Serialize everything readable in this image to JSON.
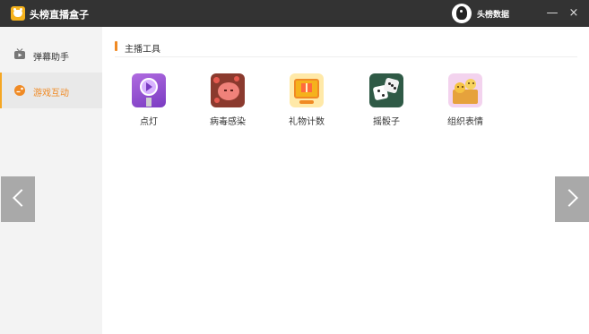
{
  "app": {
    "title": "头榜直播盒子",
    "logo_icon": "bear-face-icon"
  },
  "user": {
    "name": "头榜数据",
    "avatar_icon": "bird-avatar-icon"
  },
  "window": {
    "minimize_glyph": "—",
    "close_glyph": "×"
  },
  "sidebar": {
    "items": [
      {
        "label": "弹幕助手",
        "icon": "tv-icon",
        "active": false
      },
      {
        "label": "游戏互动",
        "icon": "game-icon",
        "active": true
      }
    ]
  },
  "main": {
    "section_title": "主播工具",
    "tools": [
      {
        "label": "点灯",
        "icon": "light-play-icon"
      },
      {
        "label": "病毒感染",
        "icon": "virus-icon"
      },
      {
        "label": "礼物计数",
        "icon": "gift-counter-icon"
      },
      {
        "label": "摇骰子",
        "icon": "dice-icon"
      },
      {
        "label": "组织表情",
        "icon": "emoji-group-icon"
      }
    ]
  },
  "colors": {
    "accent": "#f08a24",
    "titlebar": "#333333",
    "sidebar_bg": "#f3f3f3"
  }
}
